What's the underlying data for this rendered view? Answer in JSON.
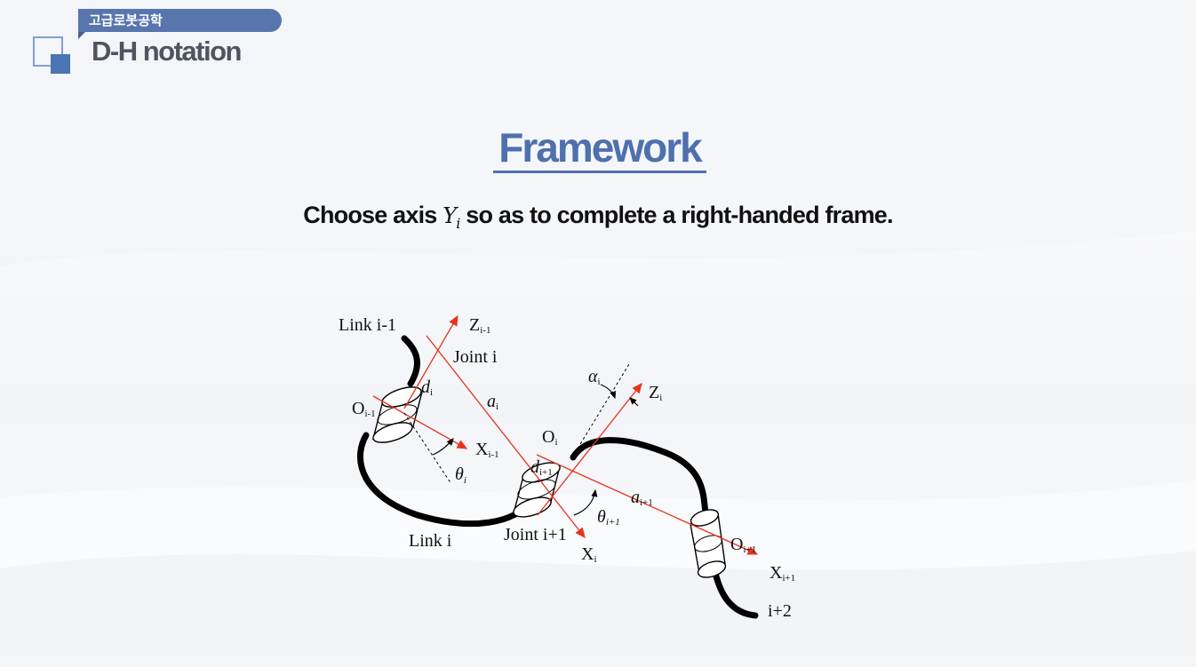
{
  "header": {
    "course": "고급로봇공학",
    "section": "D-H notation"
  },
  "slide": {
    "title": "Framework",
    "subtitle_before": "Choose axis ",
    "subtitle_axis": "Y",
    "subtitle_axis_sub": "i",
    "subtitle_after": " so as to complete a right-handed frame."
  },
  "diagram": {
    "labels": {
      "link_prev": "Link i-1",
      "z_prev": "Z",
      "z_prev_sub": "i-1",
      "joint_i": "Joint i",
      "d_i": "d",
      "d_i_sub": "i",
      "o_prev": "O",
      "o_prev_sub": "i-1",
      "a_i": "a",
      "a_i_sub": "i",
      "alpha_i": "α",
      "alpha_i_sub": "i",
      "z_i": "Z",
      "z_i_sub": "i",
      "x_prev": "X",
      "x_prev_sub": "i-1",
      "o_i": "O",
      "o_i_sub": "i",
      "theta_i": "θ",
      "theta_i_sub": "i",
      "d_next": "d",
      "d_next_sub": "i+1",
      "a_next": "a",
      "a_next_sub": "i+1",
      "theta_next": "θ",
      "theta_next_sub": "i+1",
      "link_i": "Link i",
      "joint_next": "Joint i+1",
      "x_i": "X",
      "x_i_sub": "i",
      "o_next": "O",
      "o_next_sub": "i+1",
      "x_next": "X",
      "x_next_sub": "i+1",
      "link_next": "i+2"
    },
    "colors": {
      "axis": "#e8321e",
      "link": "#000000"
    }
  },
  "colors": {
    "accent": "#4e70ad",
    "tab": "#5875ad"
  }
}
